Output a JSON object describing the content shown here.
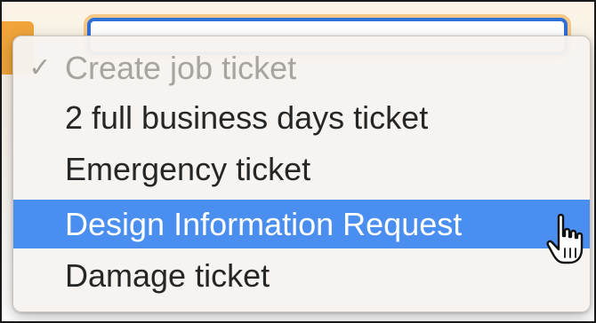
{
  "menu": {
    "items": [
      {
        "label": "Create job ticket",
        "checked": true,
        "disabled": true
      },
      {
        "label": "2 full business days ticket",
        "checked": false,
        "disabled": false
      },
      {
        "label": "Emergency ticket",
        "checked": false,
        "disabled": false
      },
      {
        "label": "Design Information Request",
        "checked": false,
        "disabled": false,
        "highlighted": true
      },
      {
        "label": "Damage ticket",
        "checked": false,
        "disabled": false
      }
    ],
    "check_glyph": "✓"
  },
  "cursor": {
    "icon": "pointing-hand-cursor-icon"
  },
  "colors": {
    "highlight": "#4a8ef0",
    "focus_ring": "#2f6fd8",
    "accent_orange": "#f0a43a"
  }
}
